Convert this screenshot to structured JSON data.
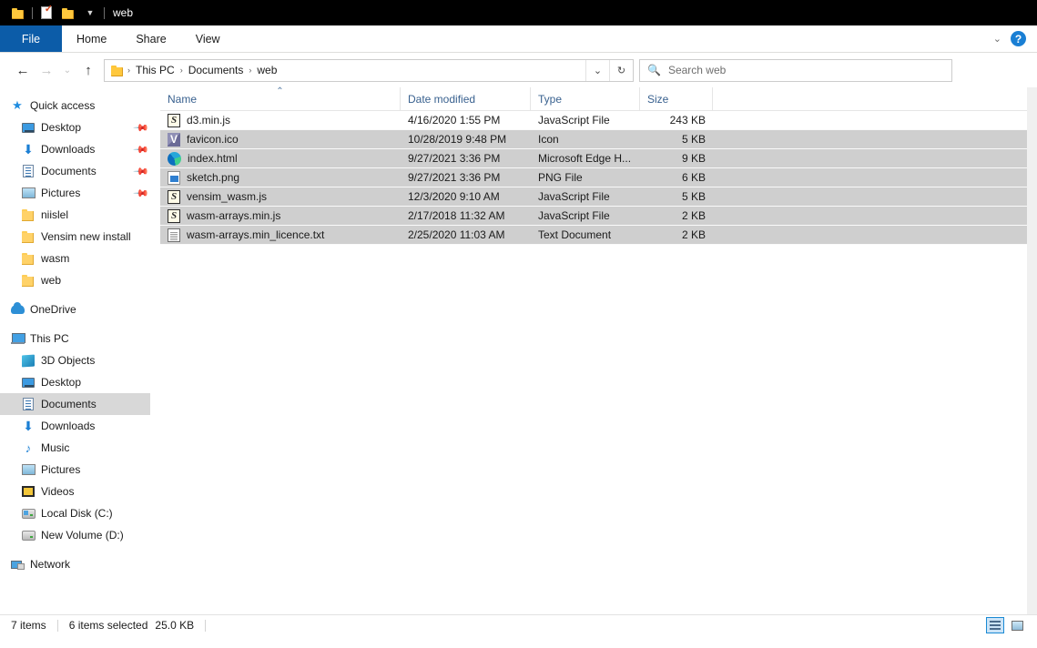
{
  "window": {
    "title": "web",
    "quick_access_toolbar": [
      {
        "name": "folder-icon",
        "label": "Properties folder"
      },
      {
        "name": "properties-icon",
        "label": "Properties"
      },
      {
        "name": "new-folder-icon",
        "label": "New folder"
      },
      {
        "name": "chevron-down-icon",
        "label": "Customize Quick Access Toolbar"
      }
    ]
  },
  "ribbon": {
    "tabs": [
      {
        "label": "File",
        "active": true
      },
      {
        "label": "Home",
        "active": false
      },
      {
        "label": "Share",
        "active": false
      },
      {
        "label": "View",
        "active": false
      }
    ],
    "expand_label": "⌄",
    "help_label": "?"
  },
  "navbar": {
    "back_label": "←",
    "forward_label": "→",
    "recent_label": "⌄",
    "up_label": "↑",
    "breadcrumb": [
      "This PC",
      "Documents",
      "web"
    ],
    "breadcrumb_separator": "›",
    "dropdown_label": "⌄",
    "refresh_label": "↻",
    "search": {
      "placeholder": "Search web",
      "value": "",
      "icon": "search-icon"
    }
  },
  "sidebar": {
    "quick_access": {
      "label": "Quick access",
      "icon": "star-pin-icon",
      "items": [
        {
          "label": "Desktop",
          "icon": "monitor-icon",
          "pinned": true
        },
        {
          "label": "Downloads",
          "icon": "download-arrow-icon",
          "pinned": true
        },
        {
          "label": "Documents",
          "icon": "documents-icon",
          "pinned": true
        },
        {
          "label": "Pictures",
          "icon": "pictures-icon",
          "pinned": true
        },
        {
          "label": "niislel",
          "icon": "folder-icon",
          "pinned": false
        },
        {
          "label": "Vensim new install",
          "icon": "folder-icon",
          "pinned": false
        },
        {
          "label": "wasm",
          "icon": "folder-icon",
          "pinned": false
        },
        {
          "label": "web",
          "icon": "folder-icon",
          "pinned": false
        }
      ]
    },
    "onedrive": {
      "label": "OneDrive",
      "icon": "cloud-icon"
    },
    "this_pc": {
      "label": "This PC",
      "icon": "computer-icon",
      "items": [
        {
          "label": "3D Objects",
          "icon": "3d-objects-icon",
          "selected": false
        },
        {
          "label": "Desktop",
          "icon": "monitor-icon",
          "selected": false
        },
        {
          "label": "Documents",
          "icon": "documents-icon",
          "selected": true
        },
        {
          "label": "Downloads",
          "icon": "download-arrow-icon",
          "selected": false
        },
        {
          "label": "Music",
          "icon": "music-note-icon",
          "selected": false
        },
        {
          "label": "Pictures",
          "icon": "pictures-icon",
          "selected": false
        },
        {
          "label": "Videos",
          "icon": "video-icon",
          "selected": false
        },
        {
          "label": "Local Disk (C:)",
          "icon": "disk-drive-icon",
          "selected": false
        },
        {
          "label": "New Volume (D:)",
          "icon": "disk-drive-icon",
          "selected": false
        }
      ]
    },
    "network": {
      "label": "Network",
      "icon": "network-icon"
    }
  },
  "filelist": {
    "columns": [
      {
        "label": "Name",
        "sorted": "asc",
        "sort_caret": "⌃"
      },
      {
        "label": "Date modified",
        "sorted": null
      },
      {
        "label": "Type",
        "sorted": null
      },
      {
        "label": "Size",
        "sorted": null
      }
    ],
    "rows": [
      {
        "name": "d3.min.js",
        "date": "4/16/2020 1:55 PM",
        "type": "JavaScript File",
        "size": "243 KB",
        "icon": "javascript-file-icon",
        "selected": false
      },
      {
        "name": "favicon.ico",
        "date": "10/28/2019 9:48 PM",
        "type": "Icon",
        "size": "5 KB",
        "icon": "icon-file-icon",
        "selected": true
      },
      {
        "name": "index.html",
        "date": "9/27/2021 3:36 PM",
        "type": "Microsoft Edge H...",
        "size": "9 KB",
        "icon": "edge-html-icon",
        "selected": true
      },
      {
        "name": "sketch.png",
        "date": "9/27/2021 3:36 PM",
        "type": "PNG File",
        "size": "6 KB",
        "icon": "png-file-icon",
        "selected": true
      },
      {
        "name": "vensim_wasm.js",
        "date": "12/3/2020 9:10 AM",
        "type": "JavaScript File",
        "size": "5 KB",
        "icon": "javascript-file-icon",
        "selected": true
      },
      {
        "name": "wasm-arrays.min.js",
        "date": "2/17/2018 11:32 AM",
        "type": "JavaScript File",
        "size": "2 KB",
        "icon": "javascript-file-icon",
        "selected": true
      },
      {
        "name": "wasm-arrays.min_licence.txt",
        "date": "2/25/2020 11:03 AM",
        "type": "Text Document",
        "size": "2 KB",
        "icon": "text-document-icon",
        "selected": true
      }
    ]
  },
  "statusbar": {
    "item_count": "7 items",
    "selection": "6 items selected",
    "selection_size": "25.0 KB",
    "details_view_label": "Details view",
    "large_icons_view_label": "Large icons view"
  },
  "colors": {
    "title_bar": "#000000",
    "file_tab": "#0c5ca8",
    "selection": "#cfcfcf",
    "sidebar_selection": "#d8d8d8",
    "header_text": "#39618f",
    "help_button": "#1a7fd4"
  }
}
